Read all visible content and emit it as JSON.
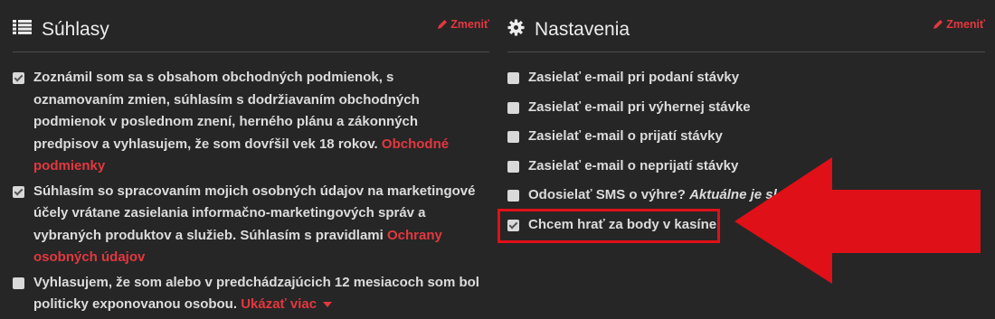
{
  "consents": {
    "title": "Súhlasy",
    "edit_label": "Zmeniť",
    "items": [
      {
        "checked": true,
        "text": "Zoznámil som sa s obsahom obchodných podmienok, s oznamovaním zmien, súhlasím s dodržiavaním obchodných podmienok v poslednom znení, herného plánu a zákonných predpisov a vyhlasujem, že som dovŕšil vek 18 rokov.",
        "link": "Obchodné podmienky"
      },
      {
        "checked": true,
        "text": "Súhlasím so spracovaním mojich osobných údajov na marketingové účely vrátane zasielania informačno-marketingových správ a vybraných produktov a služieb. Súhlasím s pravidlami",
        "link": "Ochrany osobných údajov"
      },
      {
        "checked": false,
        "text": "Vyhlasujem, že som alebo v predchádzajúcich 12 mesiacoch som bol politicky exponovanou osobou.",
        "link": "Ukázať viac"
      }
    ]
  },
  "settings": {
    "title": "Nastavenia",
    "edit_label": "Zmeniť",
    "items": [
      {
        "checked": false,
        "text": "Zasielať e-mail pri podaní stávky"
      },
      {
        "checked": false,
        "text": "Zasielať e-mail pri výhernej stávke"
      },
      {
        "checked": false,
        "text": "Zasielať e-mail o prijatí stávky"
      },
      {
        "checked": false,
        "text": "Zasielať e-mail o neprijatí stávky"
      },
      {
        "checked": false,
        "text": "Odosielať SMS o výhre?",
        "note": "Aktuálne je sl"
      },
      {
        "checked": true,
        "text": "Chcem hrať za body v kasíne"
      }
    ]
  },
  "colors": {
    "accent": "#e4373f",
    "highlight": "#e01018",
    "background": "#262626"
  },
  "icons": {
    "consents": "list-icon",
    "settings": "gear-icon",
    "edit": "pencil-icon",
    "annotation": "arrow-left-icon"
  }
}
